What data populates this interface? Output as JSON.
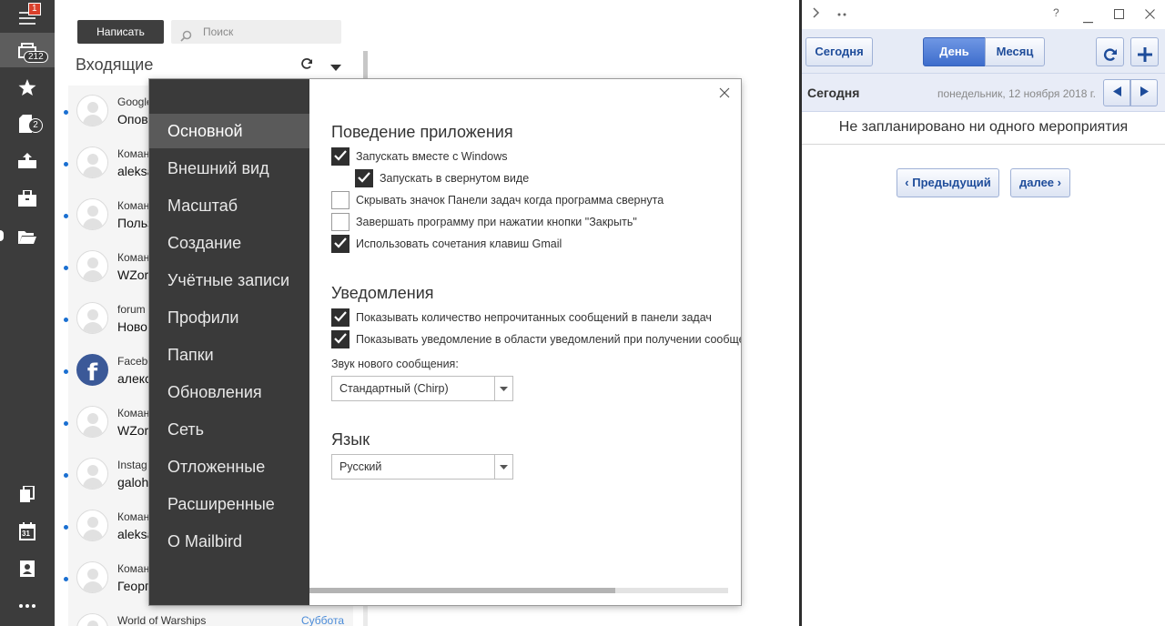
{
  "rail": {
    "menu_badge": "1",
    "inbox_count": "212",
    "drafts_count": "2",
    "calendar_day": "31"
  },
  "mail": {
    "compose_label": "Написать",
    "search_placeholder": "Поиск",
    "folder_title": "Входящие",
    "rows": [
      {
        "from": "Google",
        "subject": "Опов",
        "date": "",
        "avatar": "person"
      },
      {
        "from": "Коман",
        "subject": "aleksa",
        "date": "",
        "avatar": "person"
      },
      {
        "from": "Коман",
        "subject": "Польз",
        "date": "",
        "avatar": "person"
      },
      {
        "from": "Коман",
        "subject": "WZor",
        "date": "",
        "avatar": "person"
      },
      {
        "from": "forum",
        "subject": "Ново",
        "date": "",
        "avatar": "person"
      },
      {
        "from": "Facebo",
        "subject": "алекс",
        "date": "",
        "avatar": "facebook",
        "avatar_letter": "f"
      },
      {
        "from": "Коман",
        "subject": "WZor",
        "date": "",
        "avatar": "person"
      },
      {
        "from": "Instag",
        "subject": "galoh",
        "date": "",
        "avatar": "person"
      },
      {
        "from": "Коман",
        "subject": "aleksa",
        "date": "",
        "avatar": "person"
      },
      {
        "from": "Коман",
        "subject": "Георг",
        "date": "",
        "avatar": "person"
      },
      {
        "from": "World of Warships",
        "subject": "",
        "date": "Суббота",
        "avatar": "person"
      }
    ]
  },
  "settings": {
    "nav": [
      "Основной",
      "Внешний вид",
      "Масштаб",
      "Создание",
      "Учётные записи",
      "Профили",
      "Папки",
      "Обновления",
      "Сеть",
      "Отложенные",
      "Расширенные",
      "О Mailbird"
    ],
    "active_nav_index": 0,
    "app_behavior_title": "Поведение приложения",
    "app_behavior": [
      {
        "label": "Запускать вместе с Windows",
        "checked": true,
        "indent": false
      },
      {
        "label": "Запускать в свернутом виде",
        "checked": true,
        "indent": true
      },
      {
        "label": "Скрывать значок Панели задач когда программа свернута",
        "checked": false,
        "indent": false
      },
      {
        "label": "Завершать программу при нажатии кнопки \"Закрыть\"",
        "checked": false,
        "indent": false
      },
      {
        "label": "Использовать сочетания клавиш Gmail",
        "checked": true,
        "indent": false
      }
    ],
    "notifications_title": "Уведомления",
    "notifications": [
      {
        "label": "Показывать количество непрочитанных сообщений в панели задач",
        "checked": true
      },
      {
        "label": "Показывать уведомление в области уведомлений при получении сообщения",
        "checked": true
      }
    ],
    "sound_label": "Звук нового сообщения:",
    "sound_value": "Стандартный (Chirp)",
    "language_title": "Язык",
    "language_value": "Русский",
    "scroll_fraction": 0.73
  },
  "calendar": {
    "today_btn": "Сегодня",
    "day_btn": "День",
    "month_btn": "Месяц",
    "selected_view": "День",
    "date_heading": "Сегодня",
    "date_text": "понедельник, 12 ноября 2018 г.",
    "empty_text": "Не запланировано ни одного мероприятия",
    "prev_btn": "‹ Предыдущий",
    "next_btn": "далее ›",
    "window_help": "?"
  }
}
